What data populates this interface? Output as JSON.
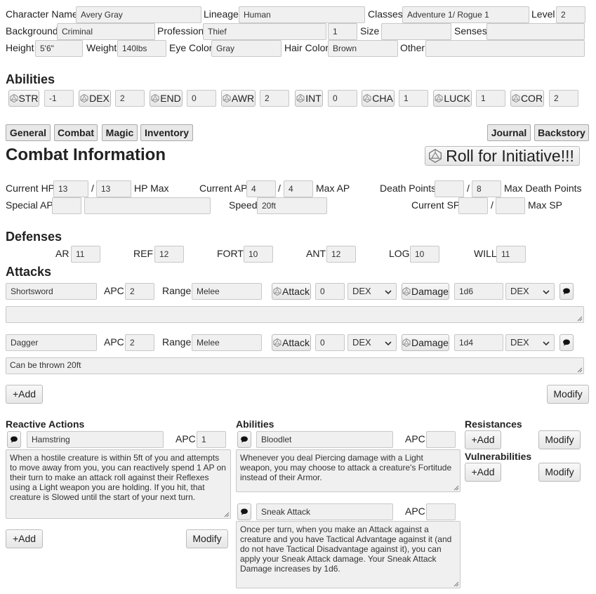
{
  "character": {
    "name_label": "Character Name",
    "name": "Avery Gray",
    "lineage_label": "Lineage",
    "lineage": "Human",
    "classes_label": "Classes",
    "classes": "Adventure 1/ Rogue 1",
    "level_label": "Level",
    "level": "2",
    "background_label": "Background",
    "background": "Criminal",
    "profession_label": "Profession",
    "profession": "Thief",
    "profession_rank": "1",
    "size_label": "Size",
    "size": "",
    "senses_label": "Senses",
    "senses": "",
    "height_label": "Height",
    "height": "5'6\"",
    "weight_label": "Weight",
    "weight": "140lbs",
    "eye_label": "Eye Color",
    "eye": "Gray",
    "hair_label": "Hair Color",
    "hair": "Brown",
    "other_label": "Other",
    "other": ""
  },
  "abilities": {
    "title": "Abilities",
    "items": [
      {
        "label": "STR",
        "value": "-1"
      },
      {
        "label": "DEX",
        "value": "2"
      },
      {
        "label": "END",
        "value": "0"
      },
      {
        "label": "AWR",
        "value": "2"
      },
      {
        "label": "INT",
        "value": "0"
      },
      {
        "label": "CHA",
        "value": "1"
      },
      {
        "label": "LUCK",
        "value": "1"
      },
      {
        "label": "COR",
        "value": "2"
      }
    ]
  },
  "tabs": {
    "general": "General",
    "combat": "Combat",
    "magic": "Magic",
    "inventory": "Inventory",
    "journal": "Journal",
    "backstory": "Backstory"
  },
  "combat": {
    "title": "Combat Information",
    "initiative_button": "Roll for Initiative!!!",
    "current_hp_label": "Current HP",
    "current_hp": "13",
    "slash": "/",
    "hp_max": "13",
    "hp_max_label": "HP Max",
    "current_ap_label": "Current AP",
    "current_ap": "4",
    "ap_max": "4",
    "ap_max_label": "Max AP",
    "death_label": "Death Points",
    "death_current": "",
    "death_max": "8",
    "death_max_label": "Max Death Points",
    "special_ap_label": "Special AP",
    "special_ap": "",
    "special_ap_note": "",
    "speed_label": "Speed",
    "speed": "20ft",
    "current_sp_label": "Current SP",
    "current_sp": "",
    "sp_max": "",
    "sp_max_label": "Max SP"
  },
  "defenses": {
    "title": "Defenses",
    "items": [
      {
        "label": "AR",
        "value": "11"
      },
      {
        "label": "REF",
        "value": "12"
      },
      {
        "label": "FORT",
        "value": "10"
      },
      {
        "label": "ANT",
        "value": "12"
      },
      {
        "label": "LOG",
        "value": "10"
      },
      {
        "label": "WILL",
        "value": "11"
      }
    ]
  },
  "attacks": {
    "title": "Attacks",
    "apc_label": "APC",
    "range_label": "Range",
    "attack_button": "Attack",
    "damage_button": "Damage",
    "items": [
      {
        "name": "Shortsword",
        "apc": "2",
        "range": "Melee",
        "attack_bonus": "0",
        "attack_stat": "DEX",
        "damage": "1d6",
        "damage_stat": "DEX",
        "notes": ""
      },
      {
        "name": "Dagger",
        "apc": "2",
        "range": "Melee",
        "attack_bonus": "0",
        "attack_stat": "DEX",
        "damage": "1d4",
        "damage_stat": "DEX",
        "notes": "Can be thrown 20ft"
      }
    ],
    "add_button": "+Add",
    "modify_button": "Modify"
  },
  "reactive": {
    "title": "Reactive Actions",
    "apc_label": "APC",
    "items": [
      {
        "name": "Hamstring",
        "apc": "1",
        "text": "When a hostile creature is within 5ft of you and attempts to move away from you, you can reactively spend 1 AP on their turn to make an attack roll against their Reflexes using a Light weapon you are holding. If you hit, that creature is Slowed until the start of your next turn."
      }
    ],
    "add_button": "+Add",
    "modify_button": "Modify"
  },
  "ability_list": {
    "title": "Abilities",
    "apc_label": "APC",
    "items": [
      {
        "name": "Bloodlet",
        "apc": "",
        "text": "Whenever you deal Piercing damage with a Light weapon, you may choose to attack a creature's Fortitude instead of their Armor."
      },
      {
        "name": "Sneak Attack",
        "apc": "",
        "text": "Once per turn, when you make an Attack against a creature and you have Tactical Advantage against it (and do not have Tactical Disadvantage against it), you can apply your Sneak Attack damage. Your Sneak Attack Damage increases by 1d6."
      }
    ]
  },
  "resistances": {
    "title": "Resistances",
    "add_button": "+Add",
    "modify_button": "Modify"
  },
  "vulnerabilities": {
    "title": "Vulnerabilities",
    "add_button": "+Add",
    "modify_button": "Modify"
  },
  "icons": {
    "die": "d20-die-icon",
    "comment": "speech-bubble-icon",
    "dropdown": "chevron-down-icon",
    "resize": "resize-grip-icon"
  }
}
